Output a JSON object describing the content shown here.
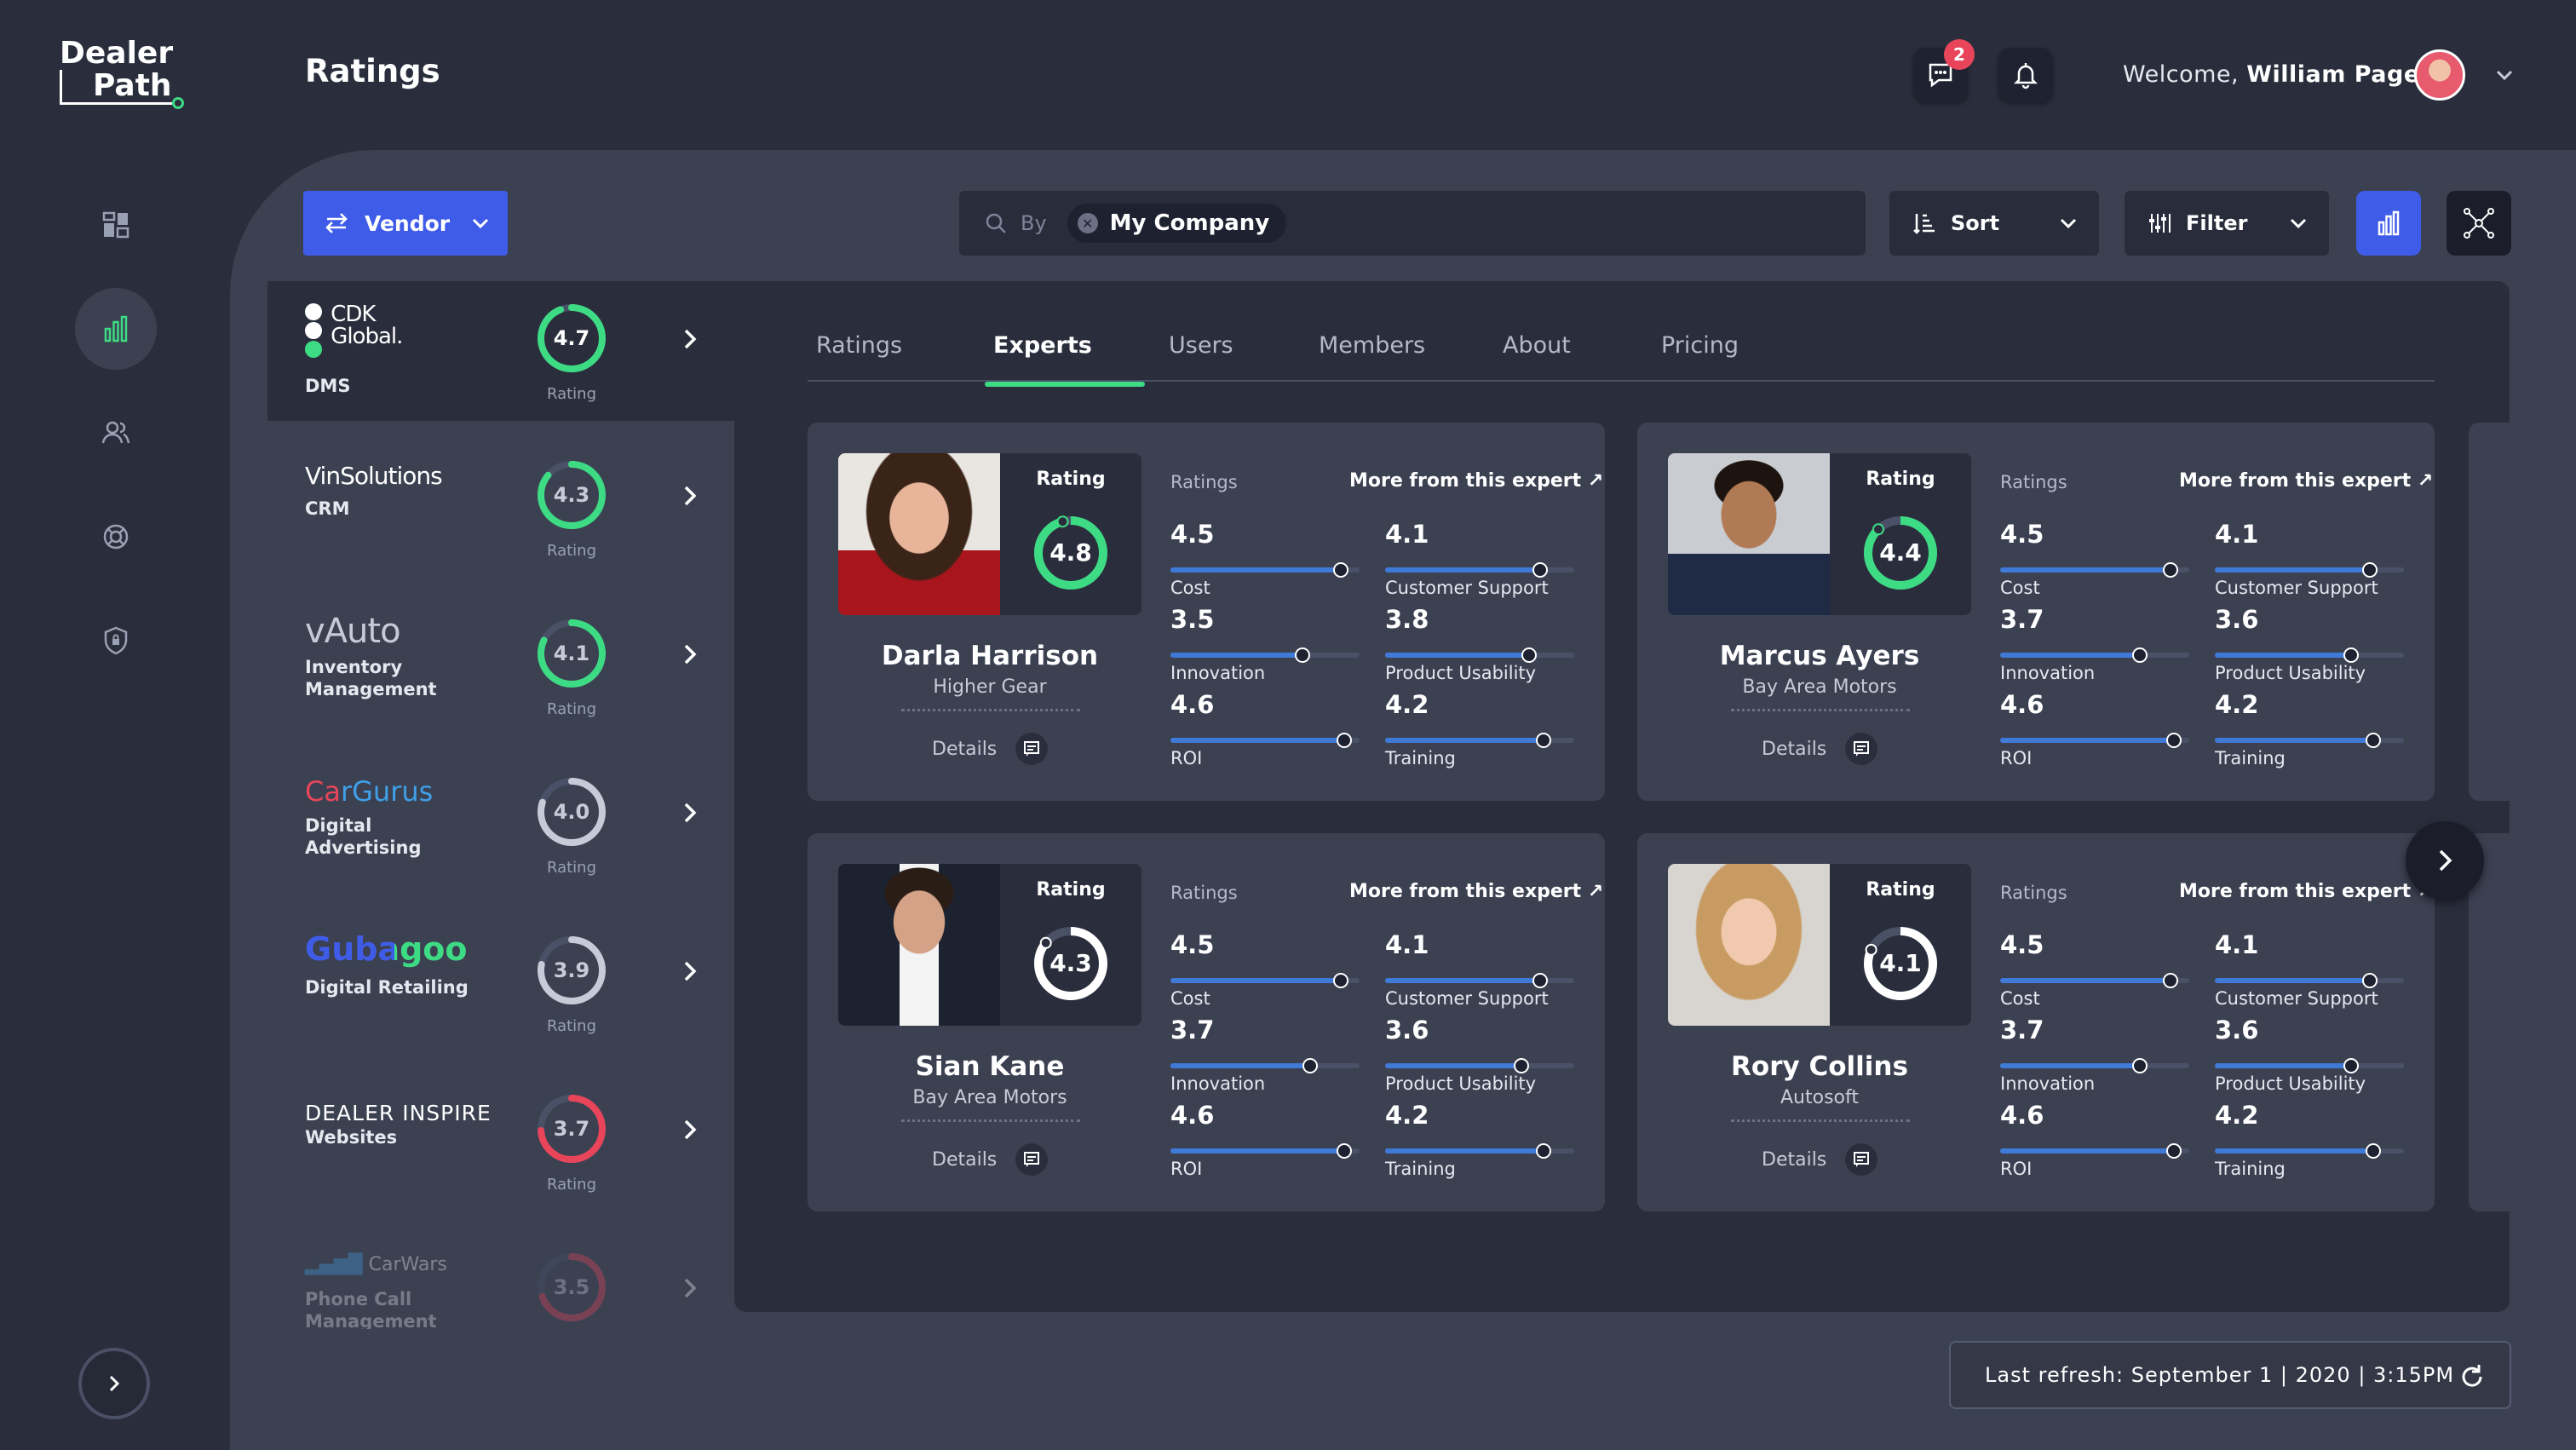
{
  "app": {
    "logo_line1": "Dealer",
    "logo_line2": "Path",
    "page_title": "Ratings"
  },
  "header": {
    "messages_badge": "2",
    "welcome_prefix": "Welcome,",
    "user_name": "William Page"
  },
  "toolbar": {
    "vendor_label": "Vendor",
    "search_by": "By",
    "search_chip": "My Company",
    "sort_label": "Sort",
    "filter_label": "Filter"
  },
  "vendors": [
    {
      "logo": "CDK Global.",
      "category": "DMS",
      "rating": "4.7",
      "rating_value": 4.7,
      "rating_label": "Rating",
      "color": "#3ddc84",
      "active": true
    },
    {
      "logo": "VinSolutions",
      "category": "CRM",
      "rating": "4.3",
      "rating_value": 4.3,
      "rating_label": "Rating",
      "color": "#3ddc84"
    },
    {
      "logo": "vAuto",
      "category": "Inventory Management",
      "rating": "4.1",
      "rating_value": 4.1,
      "rating_label": "Rating",
      "color": "#3ddc84"
    },
    {
      "logo": "CarGurus",
      "category": "Digital Advertising",
      "rating": "4.0",
      "rating_value": 4.0,
      "rating_label": "Rating",
      "color": "#c7cbd8"
    },
    {
      "logo": "Gubagoo",
      "category": "Digital Retailing",
      "rating": "3.9",
      "rating_value": 3.9,
      "rating_label": "Rating",
      "color": "#c7cbd8"
    },
    {
      "logo": "DEALER INSPIRE",
      "category": "Websites",
      "rating": "3.7",
      "rating_value": 3.7,
      "rating_label": "Rating",
      "color": "#e8455a"
    },
    {
      "logo": "CarWars",
      "category": "Phone Call Management",
      "rating": "3.5",
      "rating_value": 3.5,
      "rating_label": "Rating",
      "color": "#e8455a"
    }
  ],
  "tabs": [
    "Ratings",
    "Experts",
    "Users",
    "Members",
    "About",
    "Pricing"
  ],
  "active_tab": "Experts",
  "experts": [
    {
      "name": "Darla Harrison",
      "company": "Higher Gear",
      "rating": "4.8",
      "rating_value": 4.8,
      "rating_label": "Rating",
      "ratings_label": "Ratings",
      "more_label": "More from this expert",
      "details_label": "Details",
      "metrics": [
        {
          "value": "4.5",
          "name": "Cost"
        },
        {
          "value": "4.1",
          "name": "Customer Support"
        },
        {
          "value": "3.5",
          "name": "Innovation"
        },
        {
          "value": "3.8",
          "name": "Product Usability"
        },
        {
          "value": "4.6",
          "name": "ROI"
        },
        {
          "value": "4.2",
          "name": "Training"
        }
      ],
      "ring_color": "#3ddc84",
      "photo": "woman-red-sweater"
    },
    {
      "name": "Marcus Ayers",
      "company": "Bay Area Motors",
      "rating": "4.4",
      "rating_value": 4.4,
      "rating_label": "Rating",
      "ratings_label": "Ratings",
      "more_label": "More from this expert",
      "details_label": "Details",
      "metrics": [
        {
          "value": "4.5",
          "name": "Cost"
        },
        {
          "value": "4.1",
          "name": "Customer Support"
        },
        {
          "value": "3.7",
          "name": "Innovation"
        },
        {
          "value": "3.6",
          "name": "Product Usability"
        },
        {
          "value": "4.6",
          "name": "ROI"
        },
        {
          "value": "4.2",
          "name": "Training"
        }
      ],
      "ring_color": "#3ddc84",
      "photo": "man-navy-tshirt"
    },
    {
      "name": "Sian Kane",
      "company": "Bay Area Motors",
      "rating": "4.3",
      "rating_value": 4.3,
      "rating_label": "Rating",
      "ratings_label": "Ratings",
      "more_label": "More from this expert",
      "details_label": "Details",
      "metrics": [
        {
          "value": "4.5",
          "name": "Cost"
        },
        {
          "value": "4.1",
          "name": "Customer Support"
        },
        {
          "value": "3.7",
          "name": "Innovation"
        },
        {
          "value": "3.6",
          "name": "Product Usability"
        },
        {
          "value": "4.6",
          "name": "ROI"
        },
        {
          "value": "4.2",
          "name": "Training"
        }
      ],
      "ring_color": "#ffffff",
      "photo": "man-suit"
    },
    {
      "name": "Rory Collins",
      "company": "Autosoft",
      "rating": "4.1",
      "rating_value": 4.1,
      "rating_label": "Rating",
      "ratings_label": "Ratings",
      "more_label": "More from this expert",
      "details_label": "Details",
      "metrics": [
        {
          "value": "4.5",
          "name": "Cost"
        },
        {
          "value": "4.1",
          "name": "Customer Support"
        },
        {
          "value": "3.7",
          "name": "Innovation"
        },
        {
          "value": "3.6",
          "name": "Product Usability"
        },
        {
          "value": "4.6",
          "name": "ROI"
        },
        {
          "value": "4.2",
          "name": "Training"
        }
      ],
      "ring_color": "#ffffff",
      "photo": "woman-blonde"
    }
  ],
  "footer": {
    "last_refresh": "Last refresh: September 1 | 2020 | 3:15PM"
  },
  "colors": {
    "accent": "#3f5ce8",
    "success": "#3ddc84",
    "danger": "#e8455a",
    "bar": "#3f7ad8"
  }
}
